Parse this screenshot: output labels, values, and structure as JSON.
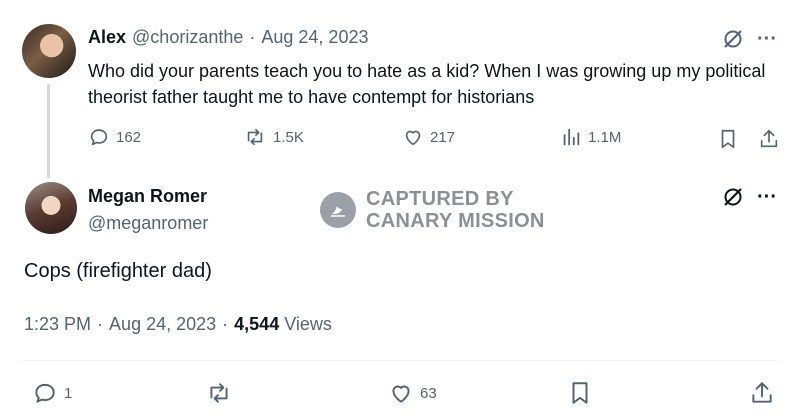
{
  "tweet1": {
    "author_name": "Alex",
    "handle": "@chorizanthe",
    "separator": "·",
    "date": "Aug 24, 2023",
    "text": "Who did your parents teach you to hate as a kid? When I was growing up my political theorist father taught me to have contempt for historians",
    "stats": {
      "replies": "162",
      "reposts": "1.5K",
      "likes": "217",
      "views": "1.1M"
    }
  },
  "tweet2": {
    "author_name": "Megan Romer",
    "handle": "@meganromer",
    "text": "Cops (firefighter dad)",
    "time": "1:23 PM",
    "separator": "·",
    "date": "Aug 24, 2023",
    "views_count": "4,544",
    "views_label": "Views",
    "stats": {
      "replies": "1",
      "likes": "63"
    }
  },
  "watermark": {
    "line1": "CAPTURED BY",
    "line2": "CANARY MISSION"
  },
  "more_glyph": "···",
  "colors": {
    "text": "#0f1419",
    "muted": "#536471",
    "thread_line": "#cfd9de",
    "watermark": "#8c9095"
  }
}
